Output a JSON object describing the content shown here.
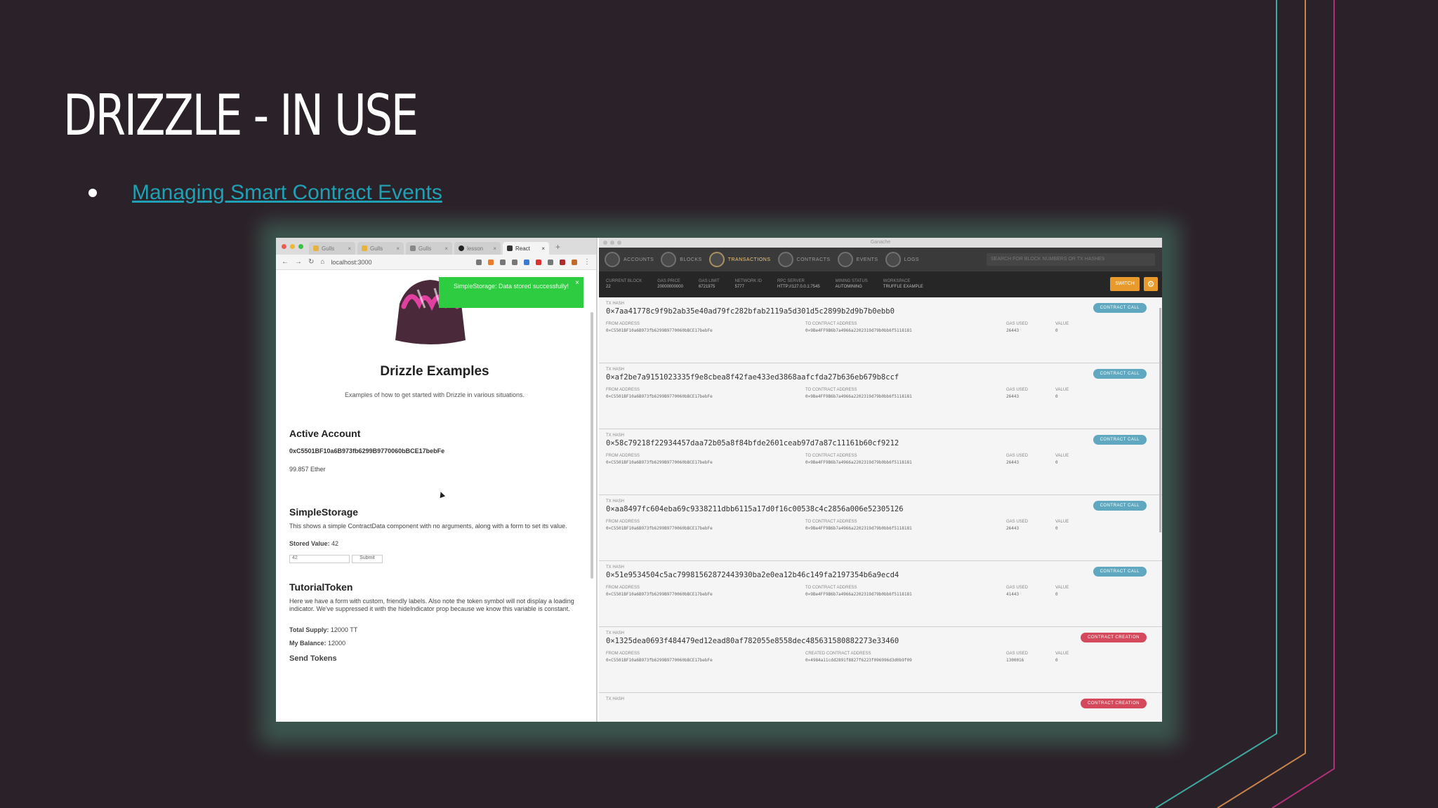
{
  "slide": {
    "title": "DRIZZLE - IN USE",
    "bullet_link": "Managing Smart Contract Events",
    "colors": {
      "background": "#2b2128",
      "link": "#20a0b4",
      "line_teal": "#3fa8a0",
      "line_orange": "#c8844a",
      "line_magenta": "#b0307a"
    }
  },
  "browser": {
    "tabs": [
      {
        "label": "Gulls",
        "icon": "folder-icon"
      },
      {
        "label": "Gulls",
        "icon": "folder-icon"
      },
      {
        "label": "Gulls",
        "icon": "doc-icon"
      },
      {
        "label": "lesson",
        "icon": "github-icon"
      },
      {
        "label": "React",
        "icon": "react-icon",
        "active": true
      }
    ],
    "new_tab": "+",
    "url": "localhost:3000",
    "toast": "SimpleStorage: Data stored successfully!",
    "toast_close": "×",
    "app_title": "Drizzle Examples",
    "app_subtitle": "Examples of how to get started with Drizzle in various situations.",
    "active_account": {
      "heading": "Active Account",
      "address": "0xC5501BF10a6B973fb6299B9770060bBCE17bebFe",
      "balance": "99.857 Ether"
    },
    "simple_storage": {
      "heading": "SimpleStorage",
      "description": "This shows a simple ContractData component with no arguments, along with a form to set its value.",
      "stored_label": "Stored Value:",
      "stored_value": "42",
      "input_value": "42",
      "submit": "Submit"
    },
    "tutorial_token": {
      "heading": "TutorialToken",
      "description": "Here we have a form with custom, friendly labels. Also note the token symbol will not display a loading indicator. We've suppressed it with the hideIndicator prop because we know this variable is constant.",
      "total_supply_label": "Total Supply:",
      "total_supply": "12000 TT",
      "my_balance_label": "My Balance:",
      "my_balance": "12000",
      "send_heading": "Send Tokens"
    }
  },
  "ganache": {
    "window_title": "Ganache",
    "nav": [
      {
        "label": "ACCOUNTS",
        "icon": "accounts-icon"
      },
      {
        "label": "BLOCKS",
        "icon": "blocks-icon"
      },
      {
        "label": "TRANSACTIONS",
        "icon": "transactions-icon",
        "active": true
      },
      {
        "label": "CONTRACTS",
        "icon": "contracts-icon"
      },
      {
        "label": "EVENTS",
        "icon": "events-icon"
      },
      {
        "label": "LOGS",
        "icon": "logs-icon"
      }
    ],
    "search_placeholder": "SEARCH FOR BLOCK NUMBERS OR TX HASHES",
    "status": [
      {
        "label": "CURRENT BLOCK",
        "value": "22"
      },
      {
        "label": "GAS PRICE",
        "value": "20000000000"
      },
      {
        "label": "GAS LIMIT",
        "value": "6721975"
      },
      {
        "label": "NETWORK ID",
        "value": "5777"
      },
      {
        "label": "RPC SERVER",
        "value": "HTTP://127.0.0.1:7545"
      },
      {
        "label": "MINING STATUS",
        "value": "AUTOMINING"
      },
      {
        "label": "WORKSPACE",
        "value": "TRUFFLE EXAMPLE"
      }
    ],
    "switch_label": "SWITCH",
    "transactions": [
      {
        "hash_label": "TX HASH",
        "hash": "0×7aa41778c9f9b2ab35e40ad79fc282bfab2119a5d301d5c2899b2d9b7b0ebb0",
        "from_label": "FROM ADDRESS",
        "from": "0×C5501BF10a6B973fb6299B9770060bBCE17bebFe",
        "to_label": "TO CONTRACT ADDRESS",
        "to": "0×9Be4FF9B6b7a4966a2202319d79b0bb6f5118181",
        "gas_label": "GAS USED",
        "gas": "26443",
        "value_label": "VALUE",
        "value": "0",
        "badge": "CONTRACT CALL",
        "type": "call"
      },
      {
        "hash_label": "TX HASH",
        "hash": "0×af2be7a9151023335f9e8cbea8f42fae433ed3868aafcfda27b636eb679b8ccf",
        "from_label": "FROM ADDRESS",
        "from": "0×C5501BF10a6B973fb6299B9770060bBCE17bebFe",
        "to_label": "TO CONTRACT ADDRESS",
        "to": "0×9Be4FF9B6b7a4966a2202319d79b0bb6f5118181",
        "gas_label": "GAS USED",
        "gas": "26443",
        "value_label": "VALUE",
        "value": "0",
        "badge": "CONTRACT CALL",
        "type": "call"
      },
      {
        "hash_label": "TX HASH",
        "hash": "0×58c79218f22934457daa72b05a8f84bfde2601ceab97d7a87c11161b60cf9212",
        "from_label": "FROM ADDRESS",
        "from": "0×C5501BF10a6B973fb6299B9770060bBCE17bebFe",
        "to_label": "TO CONTRACT ADDRESS",
        "to": "0×9Be4FF9B6b7a4966a2202319d79b0bb6f5118181",
        "gas_label": "GAS USED",
        "gas": "26443",
        "value_label": "VALUE",
        "value": "0",
        "badge": "CONTRACT CALL",
        "type": "call"
      },
      {
        "hash_label": "TX HASH",
        "hash": "0×aa8497fc604eba69c9338211dbb6115a17d0f16c00538c4c2856a006e52305126",
        "from_label": "FROM ADDRESS",
        "from": "0×C5501BF10a6B973fb6299B9770060bBCE17bebFe",
        "to_label": "TO CONTRACT ADDRESS",
        "to": "0×9Be4FF9B6b7a4966a2202319d79b0bb6f5118181",
        "gas_label": "GAS USED",
        "gas": "26443",
        "value_label": "VALUE",
        "value": "0",
        "badge": "CONTRACT CALL",
        "type": "call"
      },
      {
        "hash_label": "TX HASH",
        "hash": "0×51e9534504c5ac79981562872443930ba2e0ea12b46c149fa2197354b6a9ecd4",
        "from_label": "FROM ADDRESS",
        "from": "0×C5501BF10a6B973fb6299B9770060bBCE17bebFe",
        "to_label": "TO CONTRACT ADDRESS",
        "to": "0×9Be4FF9B6b7a4966a2202319d79b0bb6f5118181",
        "gas_label": "GAS USED",
        "gas": "41443",
        "value_label": "VALUE",
        "value": "0",
        "badge": "CONTRACT CALL",
        "type": "call"
      },
      {
        "hash_label": "TX HASH",
        "hash": "0×1325dea0693f484479ed12ead80af782055e8558dec485631580882273e33460",
        "from_label": "FROM ADDRESS",
        "from": "0×C5501BF10a6B973fb6299B9770060bBCE17bebFe",
        "to_label": "CREATED CONTRACT ADDRESS",
        "to": "0×4984a11cdd2891f8827f6223f096996d3d0b9f09",
        "gas_label": "GAS USED",
        "gas": "1300016",
        "value_label": "VALUE",
        "value": "0",
        "badge": "CONTRACT CREATION",
        "type": "creation"
      },
      {
        "hash_label": "TX HASH",
        "hash": "",
        "from_label": "",
        "from": "",
        "to_label": "",
        "to": "",
        "gas_label": "",
        "gas": "",
        "value_label": "",
        "value": "",
        "badge": "CONTRACT CREATION",
        "type": "creation"
      }
    ]
  }
}
